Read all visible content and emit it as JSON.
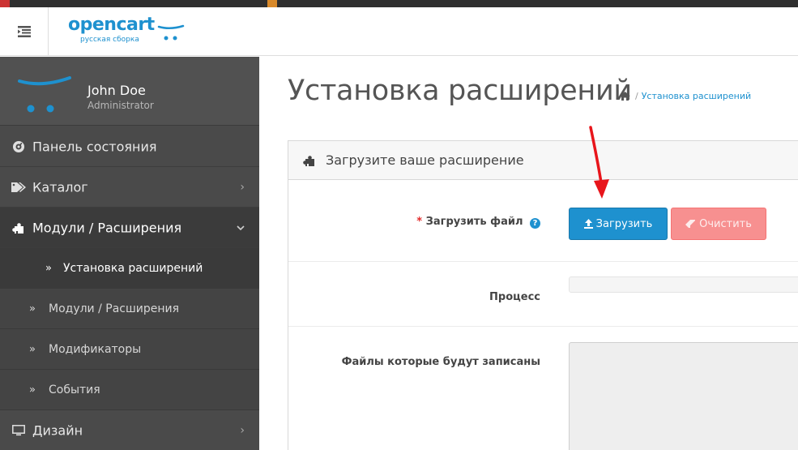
{
  "header": {
    "logo_text": "opencart",
    "logo_subtitle": "русская сборка"
  },
  "sidebar": {
    "user": {
      "name": "John Doe",
      "role": "Administrator"
    },
    "items": [
      {
        "label": "Панель состояния",
        "icon": "dashboard-icon"
      },
      {
        "label": "Каталог",
        "icon": "tag-icon"
      },
      {
        "label": "Модули / Расширения",
        "icon": "puzzle-icon",
        "expanded": true
      },
      {
        "label": "Дизайн",
        "icon": "monitor-icon"
      }
    ],
    "subitems": [
      {
        "label": "Установка расширений",
        "current": true
      },
      {
        "label": "Модули / Расширения"
      },
      {
        "label": "Модификаторы"
      },
      {
        "label": "События"
      }
    ]
  },
  "main": {
    "page_title": "Установка расширений",
    "breadcrumb": {
      "home_icon": "home-icon",
      "separator": "/",
      "current": "Установка расширений"
    },
    "panel": {
      "title": "Загрузите ваше расширение",
      "upload_label_required": "*",
      "upload_label": "Загрузить файл",
      "help_glyph": "?",
      "upload_button": "Загрузить",
      "clear_button": "Очистить",
      "progress_label": "Процесс",
      "progress_value": 0,
      "files_label": "Файлы которые будут записаны"
    }
  },
  "colors": {
    "primary": "#1e91cf",
    "danger": "#f56b6b",
    "sidebar_bg": "#4a4a4a",
    "annotation_arrow": "#e8151b"
  }
}
